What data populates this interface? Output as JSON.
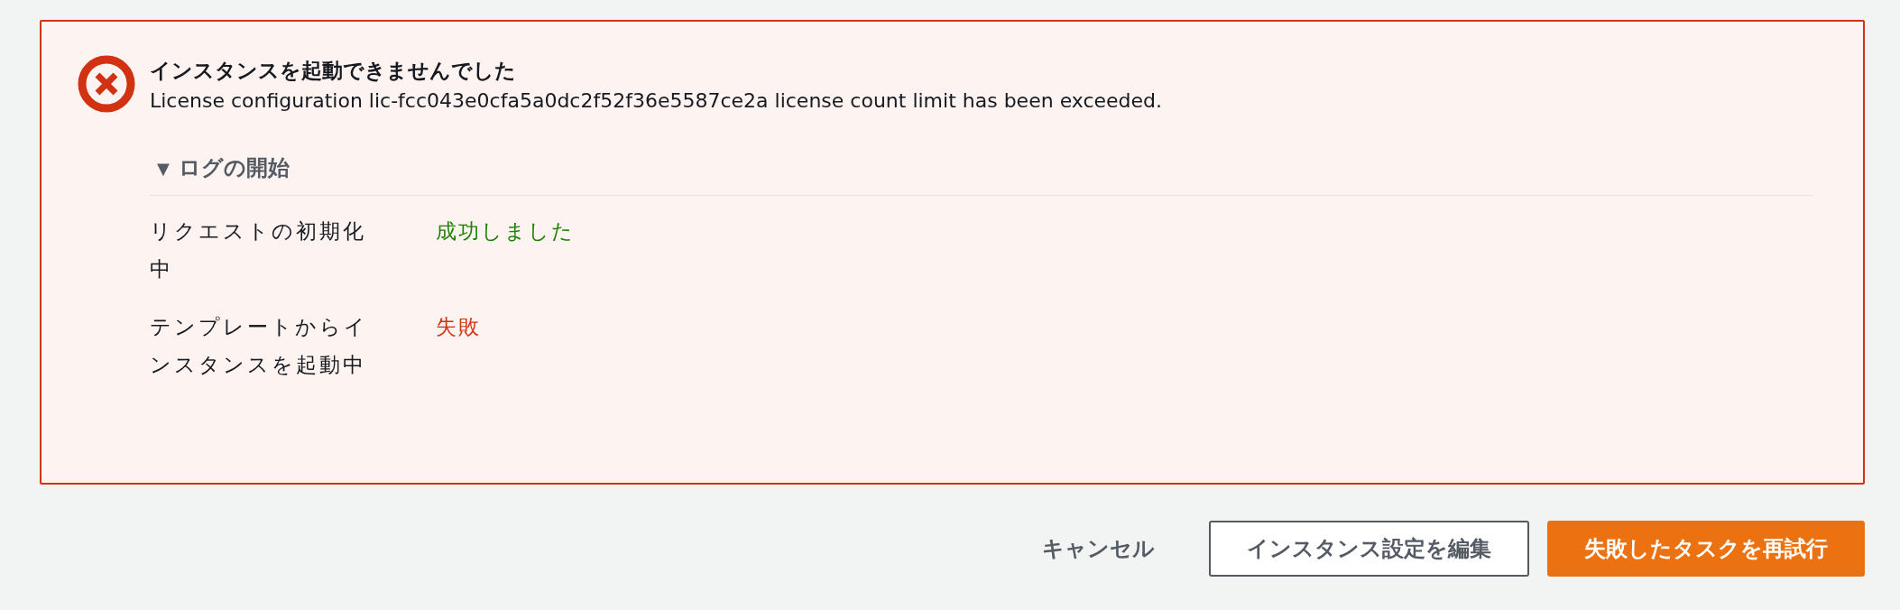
{
  "alert": {
    "kind": "error",
    "title": "インスタンスを起動できませんでした",
    "message": "License configuration lic-fcc043e0cfa5a0dc2f52f36e5587ce2a license count limit has been exceeded.",
    "log": {
      "toggle": "▼",
      "label": "ログの開始",
      "expanded": true,
      "rows": [
        {
          "step": "リクエストの初期化中",
          "status": "成功しました",
          "kind": "success"
        },
        {
          "step": "テンプレートからインスタンスを起動中",
          "status": "失敗",
          "kind": "failure"
        }
      ]
    }
  },
  "buttons": [
    {
      "label": "キャンセル",
      "kind": "link"
    },
    {
      "label": "インスタンス設定を編集",
      "kind": "normal"
    },
    {
      "label": "失敗したタスクを再試行",
      "kind": "primary"
    }
  ]
}
